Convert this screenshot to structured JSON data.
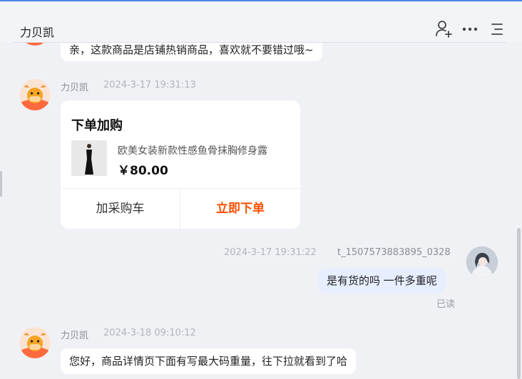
{
  "header": {
    "title": "力贝凯"
  },
  "messages": {
    "m1": {
      "text": "亲，这款商品是店铺热销商品，喜欢就不要错过哦~"
    },
    "m2": {
      "sender": "力贝凯",
      "time": "2024-3-17 19:31:13",
      "card": {
        "title": "下单加购",
        "product_name": "欧美女装新款性感鱼骨抹胸修身露",
        "price": "￥80.00",
        "add_cart_label": "加采购车",
        "buy_now_label": "立即下单"
      }
    },
    "m3": {
      "time": "2024-3-17 19:31:22",
      "sender": "t_1507573883895_0328",
      "text": "是有货的吗 一件多重呢",
      "status": "已读"
    },
    "m4": {
      "sender": "力贝凯",
      "time": "2024-3-18 09:10:12",
      "text": "您好，商品详情页下面有写最大码重量，往下拉就看到了哈"
    }
  },
  "colors": {
    "accent": "#ff5000",
    "my_bubble": "#e6eeff",
    "bg": "#f0f1f5"
  },
  "icons": [
    "add-user-icon",
    "more-icon",
    "menu-icon"
  ]
}
